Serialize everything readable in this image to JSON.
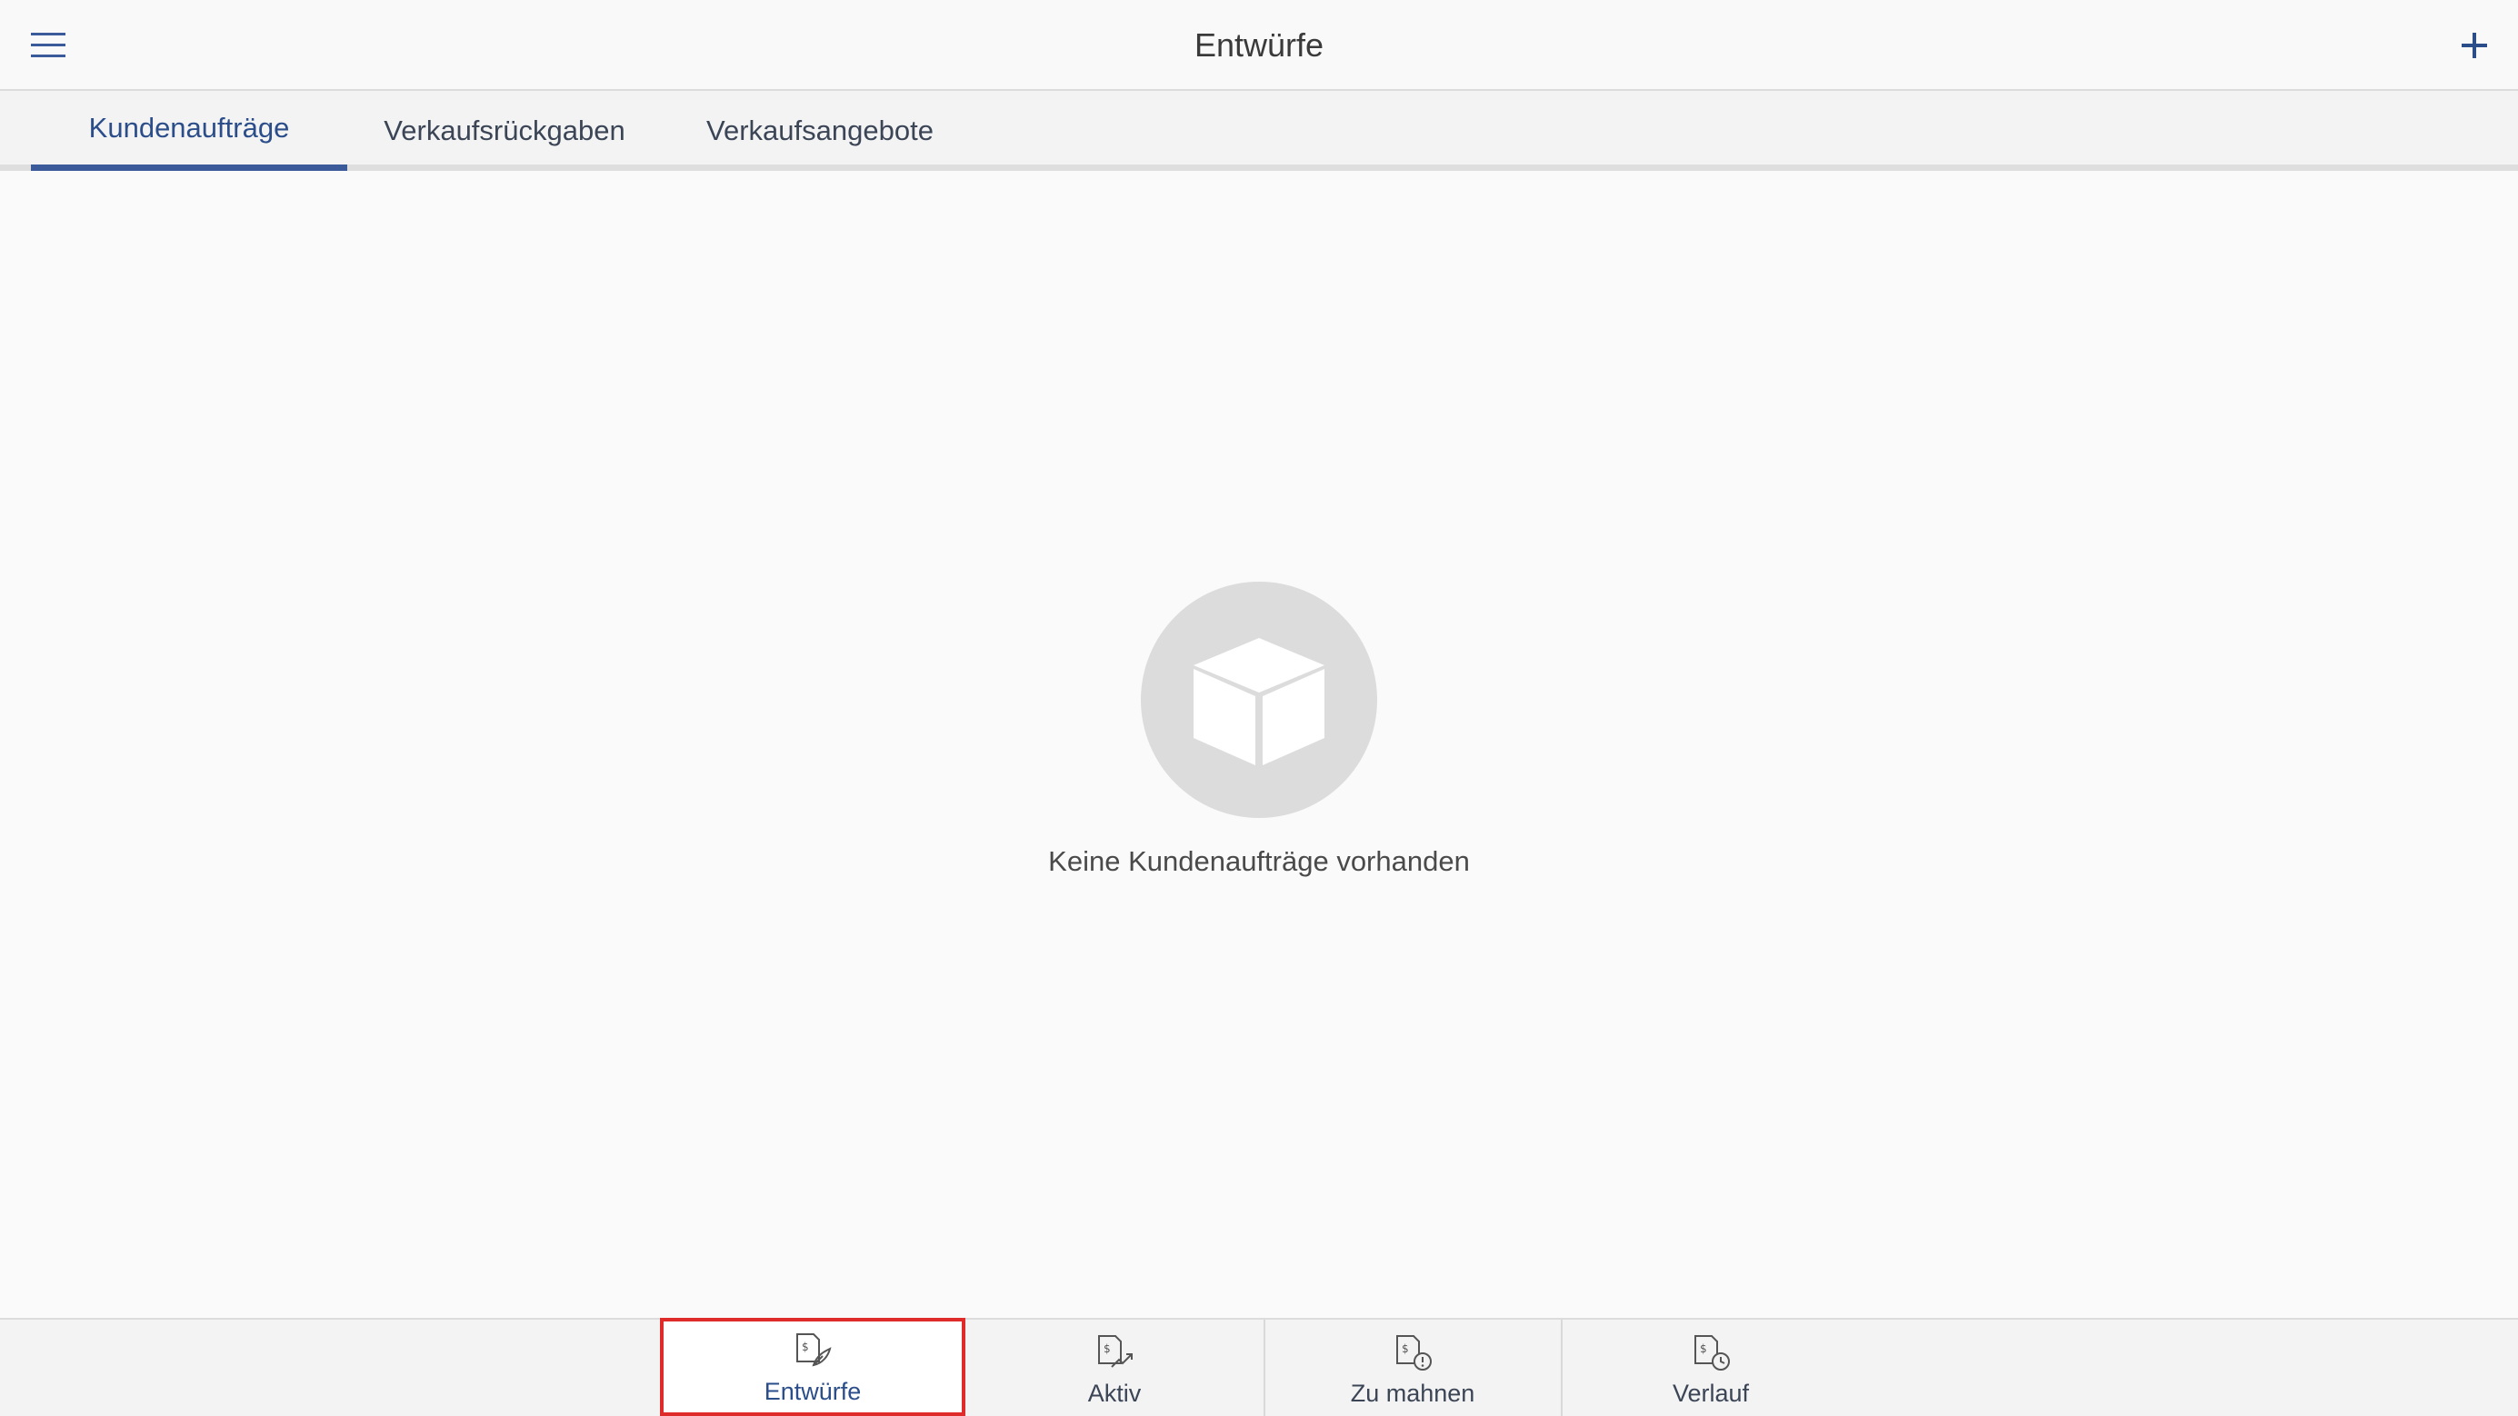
{
  "header": {
    "title": "Entwürfe",
    "menu_icon": "hamburger-menu-icon",
    "add_icon": "plus-icon"
  },
  "tabs": [
    {
      "label": "Kundenaufträge",
      "active": true
    },
    {
      "label": "Verkaufsrückgaben",
      "active": false
    },
    {
      "label": "Verkaufsangebote",
      "active": false
    }
  ],
  "empty_state": {
    "icon": "box-icon",
    "message": "Keine Kundenaufträge vorhanden"
  },
  "bottom_nav": [
    {
      "label": "Entwürfe",
      "icon": "draft-document-icon",
      "selected": true
    },
    {
      "label": "Aktiv",
      "icon": "active-document-icon",
      "selected": false
    },
    {
      "label": "Zu mahnen",
      "icon": "overdue-document-icon",
      "selected": false
    },
    {
      "label": "Verlauf",
      "icon": "history-document-icon",
      "selected": false
    }
  ],
  "colors": {
    "accent": "#2b4e8a",
    "tab_indicator": "#3a5a9a",
    "selection_outline": "#e02b2b",
    "empty_circle": "#dcdcdc"
  }
}
